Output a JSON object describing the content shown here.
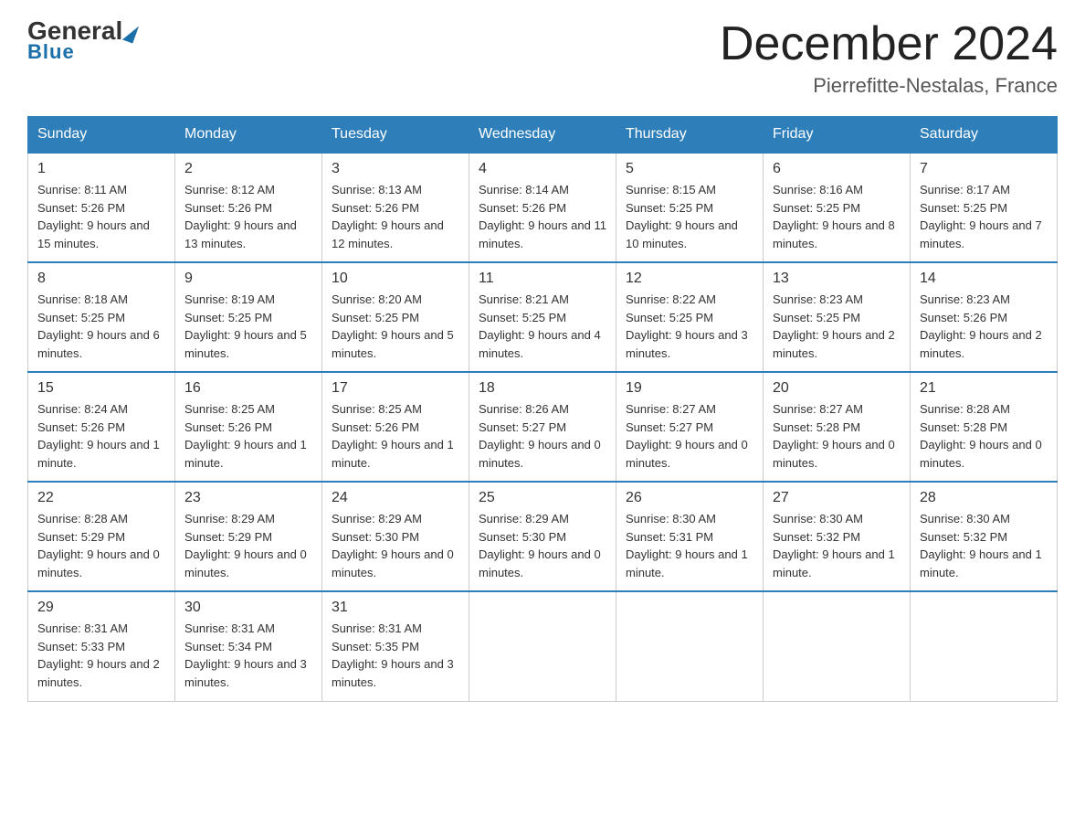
{
  "logo": {
    "text_general": "General",
    "triangle": "▶",
    "text_blue": "Blue"
  },
  "title": "December 2024",
  "location": "Pierrefitte-Nestalas, France",
  "days_of_week": [
    "Sunday",
    "Monday",
    "Tuesday",
    "Wednesday",
    "Thursday",
    "Friday",
    "Saturday"
  ],
  "weeks": [
    [
      {
        "day": "1",
        "sunrise": "8:11 AM",
        "sunset": "5:26 PM",
        "daylight": "9 hours and 15 minutes."
      },
      {
        "day": "2",
        "sunrise": "8:12 AM",
        "sunset": "5:26 PM",
        "daylight": "9 hours and 13 minutes."
      },
      {
        "day": "3",
        "sunrise": "8:13 AM",
        "sunset": "5:26 PM",
        "daylight": "9 hours and 12 minutes."
      },
      {
        "day": "4",
        "sunrise": "8:14 AM",
        "sunset": "5:26 PM",
        "daylight": "9 hours and 11 minutes."
      },
      {
        "day": "5",
        "sunrise": "8:15 AM",
        "sunset": "5:25 PM",
        "daylight": "9 hours and 10 minutes."
      },
      {
        "day": "6",
        "sunrise": "8:16 AM",
        "sunset": "5:25 PM",
        "daylight": "9 hours and 8 minutes."
      },
      {
        "day": "7",
        "sunrise": "8:17 AM",
        "sunset": "5:25 PM",
        "daylight": "9 hours and 7 minutes."
      }
    ],
    [
      {
        "day": "8",
        "sunrise": "8:18 AM",
        "sunset": "5:25 PM",
        "daylight": "9 hours and 6 minutes."
      },
      {
        "day": "9",
        "sunrise": "8:19 AM",
        "sunset": "5:25 PM",
        "daylight": "9 hours and 5 minutes."
      },
      {
        "day": "10",
        "sunrise": "8:20 AM",
        "sunset": "5:25 PM",
        "daylight": "9 hours and 5 minutes."
      },
      {
        "day": "11",
        "sunrise": "8:21 AM",
        "sunset": "5:25 PM",
        "daylight": "9 hours and 4 minutes."
      },
      {
        "day": "12",
        "sunrise": "8:22 AM",
        "sunset": "5:25 PM",
        "daylight": "9 hours and 3 minutes."
      },
      {
        "day": "13",
        "sunrise": "8:23 AM",
        "sunset": "5:25 PM",
        "daylight": "9 hours and 2 minutes."
      },
      {
        "day": "14",
        "sunrise": "8:23 AM",
        "sunset": "5:26 PM",
        "daylight": "9 hours and 2 minutes."
      }
    ],
    [
      {
        "day": "15",
        "sunrise": "8:24 AM",
        "sunset": "5:26 PM",
        "daylight": "9 hours and 1 minute."
      },
      {
        "day": "16",
        "sunrise": "8:25 AM",
        "sunset": "5:26 PM",
        "daylight": "9 hours and 1 minute."
      },
      {
        "day": "17",
        "sunrise": "8:25 AM",
        "sunset": "5:26 PM",
        "daylight": "9 hours and 1 minute."
      },
      {
        "day": "18",
        "sunrise": "8:26 AM",
        "sunset": "5:27 PM",
        "daylight": "9 hours and 0 minutes."
      },
      {
        "day": "19",
        "sunrise": "8:27 AM",
        "sunset": "5:27 PM",
        "daylight": "9 hours and 0 minutes."
      },
      {
        "day": "20",
        "sunrise": "8:27 AM",
        "sunset": "5:28 PM",
        "daylight": "9 hours and 0 minutes."
      },
      {
        "day": "21",
        "sunrise": "8:28 AM",
        "sunset": "5:28 PM",
        "daylight": "9 hours and 0 minutes."
      }
    ],
    [
      {
        "day": "22",
        "sunrise": "8:28 AM",
        "sunset": "5:29 PM",
        "daylight": "9 hours and 0 minutes."
      },
      {
        "day": "23",
        "sunrise": "8:29 AM",
        "sunset": "5:29 PM",
        "daylight": "9 hours and 0 minutes."
      },
      {
        "day": "24",
        "sunrise": "8:29 AM",
        "sunset": "5:30 PM",
        "daylight": "9 hours and 0 minutes."
      },
      {
        "day": "25",
        "sunrise": "8:29 AM",
        "sunset": "5:30 PM",
        "daylight": "9 hours and 0 minutes."
      },
      {
        "day": "26",
        "sunrise": "8:30 AM",
        "sunset": "5:31 PM",
        "daylight": "9 hours and 1 minute."
      },
      {
        "day": "27",
        "sunrise": "8:30 AM",
        "sunset": "5:32 PM",
        "daylight": "9 hours and 1 minute."
      },
      {
        "day": "28",
        "sunrise": "8:30 AM",
        "sunset": "5:32 PM",
        "daylight": "9 hours and 1 minute."
      }
    ],
    [
      {
        "day": "29",
        "sunrise": "8:31 AM",
        "sunset": "5:33 PM",
        "daylight": "9 hours and 2 minutes."
      },
      {
        "day": "30",
        "sunrise": "8:31 AM",
        "sunset": "5:34 PM",
        "daylight": "9 hours and 3 minutes."
      },
      {
        "day": "31",
        "sunrise": "8:31 AM",
        "sunset": "5:35 PM",
        "daylight": "9 hours and 3 minutes."
      },
      null,
      null,
      null,
      null
    ]
  ]
}
